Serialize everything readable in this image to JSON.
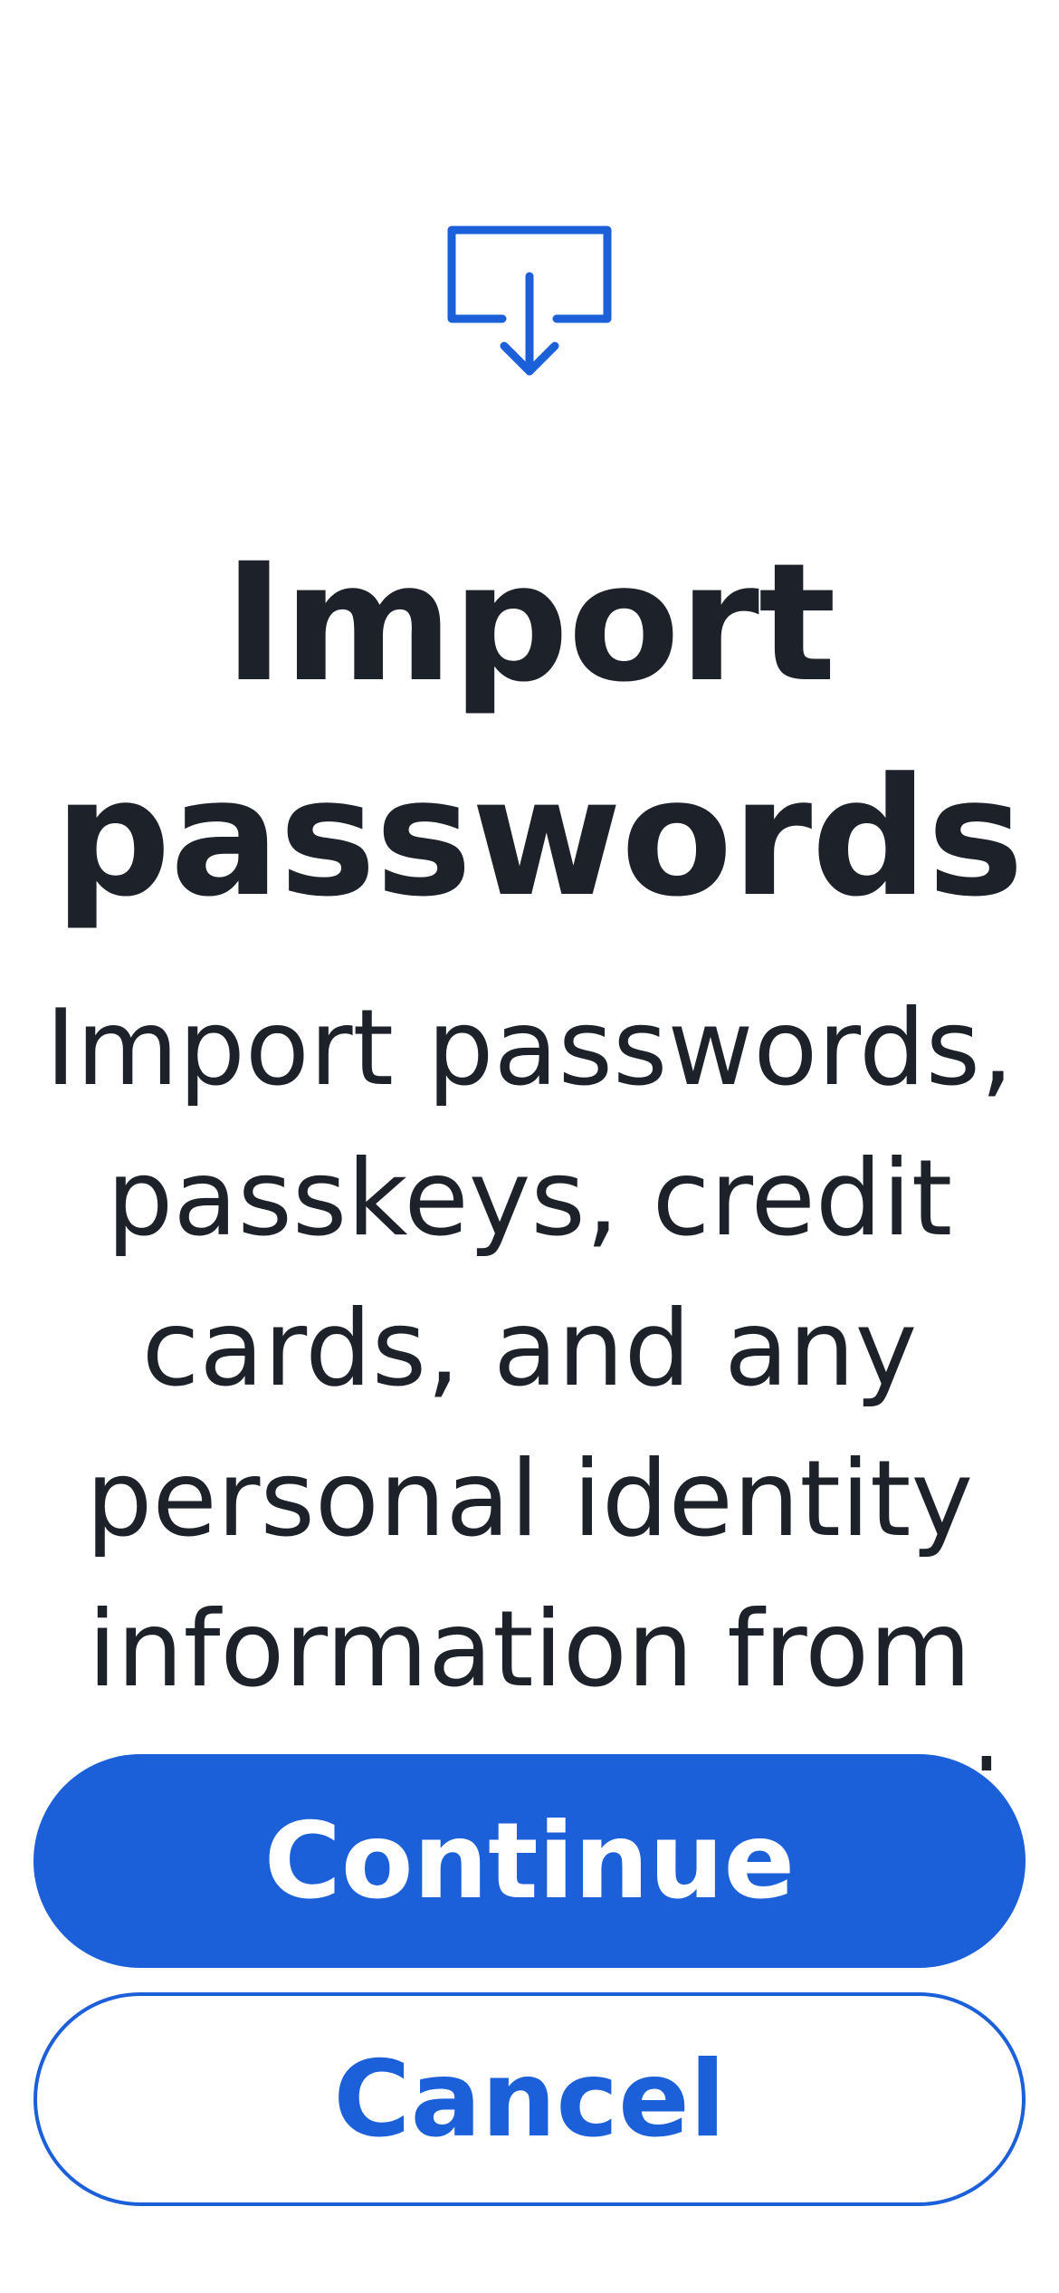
{
  "colors": {
    "accent": "#1b5fd9",
    "text": "#1d2129",
    "background": "#ffffff"
  },
  "header": {
    "icon": "import-tray-icon",
    "title": "Import passwords"
  },
  "body": {
    "description": "Import passwords, passkeys, credit cards, and any personal identity information from another password manager."
  },
  "actions": {
    "continue_label": "Continue",
    "cancel_label": "Cancel"
  }
}
